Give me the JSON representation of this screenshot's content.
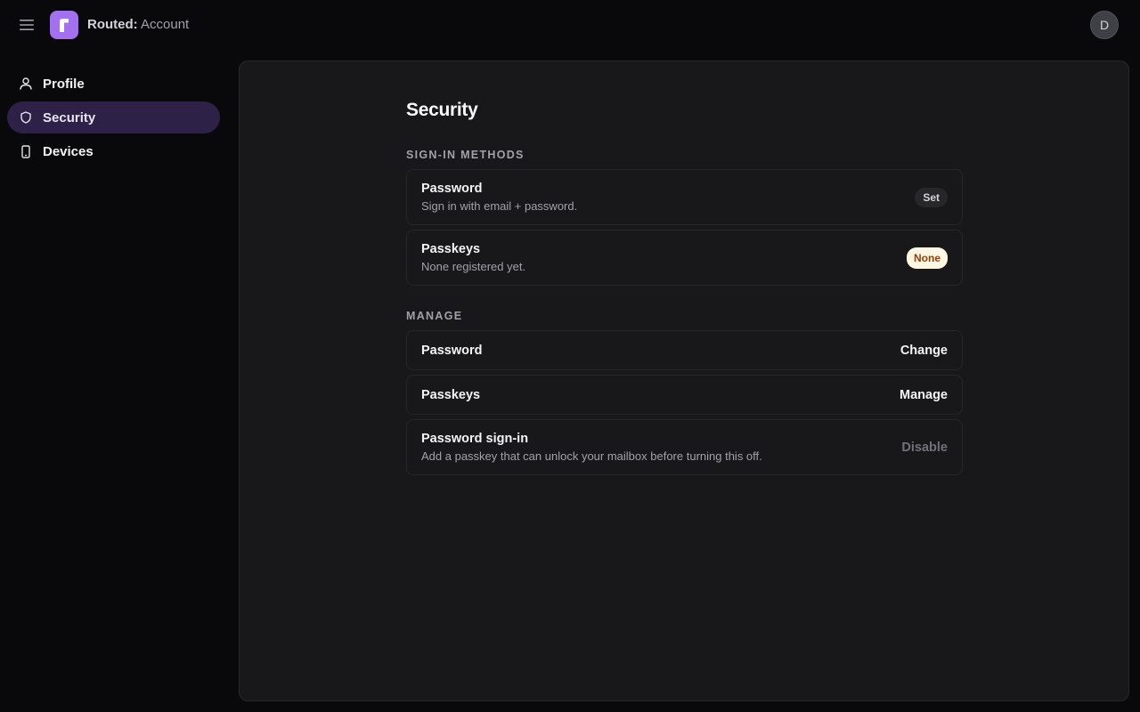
{
  "header": {
    "brand": "Routed:",
    "section": "Account",
    "logo_letter": "r",
    "avatar_initial": "D",
    "menu_icon": "hamburger-icon"
  },
  "sidebar": {
    "items": [
      {
        "label": "Profile",
        "icon": "user-icon",
        "active": false
      },
      {
        "label": "Security",
        "icon": "shield-icon",
        "active": true
      },
      {
        "label": "Devices",
        "icon": "phone-icon",
        "active": false
      }
    ]
  },
  "main": {
    "title": "Security",
    "sign_in_methods": {
      "label": "SIGN-IN METHODS",
      "items": [
        {
          "title": "Password",
          "desc": "Sign in with email + password.",
          "badge": "Set"
        },
        {
          "title": "Passkeys",
          "desc": "None registered yet.",
          "badge": "None"
        }
      ]
    },
    "manage": {
      "label": "MANAGE",
      "items": [
        {
          "title": "Password",
          "action": "Change"
        },
        {
          "title": "Passkeys",
          "action": "Manage"
        },
        {
          "title": "Password sign-in",
          "desc": "Add a passkey that can unlock your mailbox before turning this off.",
          "action": "Disable",
          "disabled": true
        }
      ]
    }
  },
  "colors": {
    "accent": "#a371f0",
    "active_nav_bg": "#2e2148",
    "panel_bg": "#18181b",
    "page_bg": "#09090b",
    "none_badge_bg": "#fdf6e3",
    "none_badge_text": "#92400e"
  }
}
